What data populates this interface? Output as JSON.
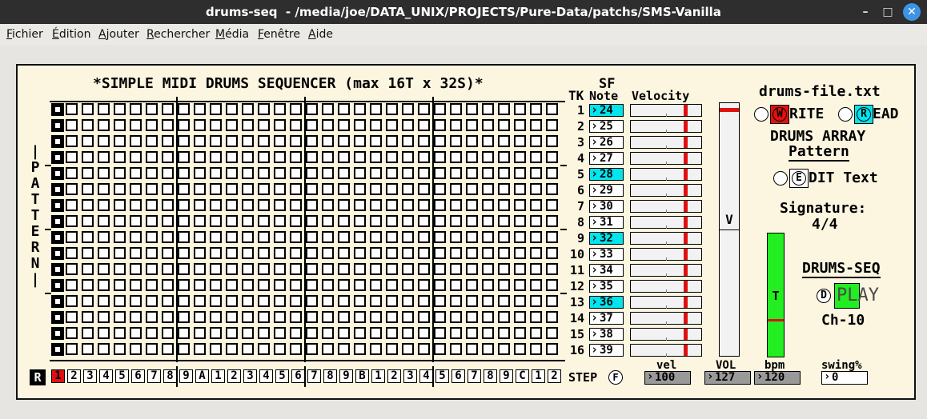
{
  "window": {
    "title": "drums-seq  - /media/joe/DATA_UNIX/PROJECTS/Pure-Data/patchs/SMS-Vanilla",
    "minimize": "–",
    "maximize": "□",
    "close": "✕"
  },
  "menu": [
    {
      "u": "F",
      "rest": "ichier"
    },
    {
      "u": "É",
      "rest": "dition"
    },
    {
      "u": "A",
      "rest": "jouter"
    },
    {
      "u": "R",
      "rest": "echercher"
    },
    {
      "u": "M",
      "rest": "édia"
    },
    {
      "u": "F",
      "rest": "enêtre"
    },
    {
      "u": "A",
      "rest": "ide"
    }
  ],
  "patch": {
    "heading": "*SIMPLE MIDI DRUMS SEQUENCER (max 16T x 32S)*",
    "pattern_label": [
      "|",
      "P",
      "A",
      "T",
      "T",
      "E",
      "R",
      "N",
      "|"
    ],
    "tk_header": "TK",
    "sf_header": "SF",
    "note_header": "Note",
    "velocity_header": "Velocity",
    "tracks": [
      {
        "num": "1",
        "note": "24",
        "sf": true
      },
      {
        "num": "2",
        "note": "25",
        "sf": false
      },
      {
        "num": "3",
        "note": "26",
        "sf": false
      },
      {
        "num": "4",
        "note": "27",
        "sf": false
      },
      {
        "num": "5",
        "note": "28",
        "sf": true
      },
      {
        "num": "6",
        "note": "29",
        "sf": false
      },
      {
        "num": "7",
        "note": "30",
        "sf": false
      },
      {
        "num": "8",
        "note": "31",
        "sf": false
      },
      {
        "num": "9",
        "note": "32",
        "sf": true
      },
      {
        "num": "10",
        "note": "33",
        "sf": false
      },
      {
        "num": "11",
        "note": "34",
        "sf": false
      },
      {
        "num": "12",
        "note": "35",
        "sf": false
      },
      {
        "num": "13",
        "note": "36",
        "sf": true
      },
      {
        "num": "14",
        "note": "37",
        "sf": false
      },
      {
        "num": "15",
        "note": "38",
        "sf": false
      },
      {
        "num": "16",
        "note": "39",
        "sf": false
      }
    ],
    "velocity_level": 0.75,
    "step_labels": [
      "1",
      "2",
      "3",
      "4",
      "5",
      "6",
      "7",
      "8",
      "9",
      "A",
      "1",
      "2",
      "3",
      "4",
      "5",
      "6",
      "7",
      "8",
      "9",
      "B",
      "1",
      "2",
      "3",
      "4",
      "5",
      "6",
      "7",
      "8",
      "9",
      "C",
      "1",
      "2"
    ],
    "active_step": 1,
    "step_label": "STEP",
    "f_button": "F",
    "r_button": "R",
    "vel_label": "vel",
    "vel_value": "100",
    "vol_label": "VOL",
    "vol_value": "127",
    "vol_slider_letter": "V",
    "bpm_label": "bpm",
    "bpm_value": "120",
    "tempo_slider_letter": "T",
    "swing_label": "swing%",
    "swing_value": "0",
    "file_name": "drums-file.txt",
    "write_initial": "W",
    "write_rest": "RITE",
    "read_initial": "R",
    "read_rest": "EAD",
    "drums_array": "DRUMS ARRAY",
    "pattern_link": "Pattern",
    "edit_initial": "E",
    "edit_rest": "DIT Text",
    "signature_label": "Signature:",
    "signature_value": "4/4",
    "drums_seq": "DRUMS-SEQ",
    "play_d": "D",
    "play_label": "PLAY",
    "channel": "Ch-10",
    "colors": {
      "cyan": "#00e5ee",
      "red": "#e01010",
      "green": "#22ee22",
      "canvas": "#fcf5e0"
    }
  }
}
